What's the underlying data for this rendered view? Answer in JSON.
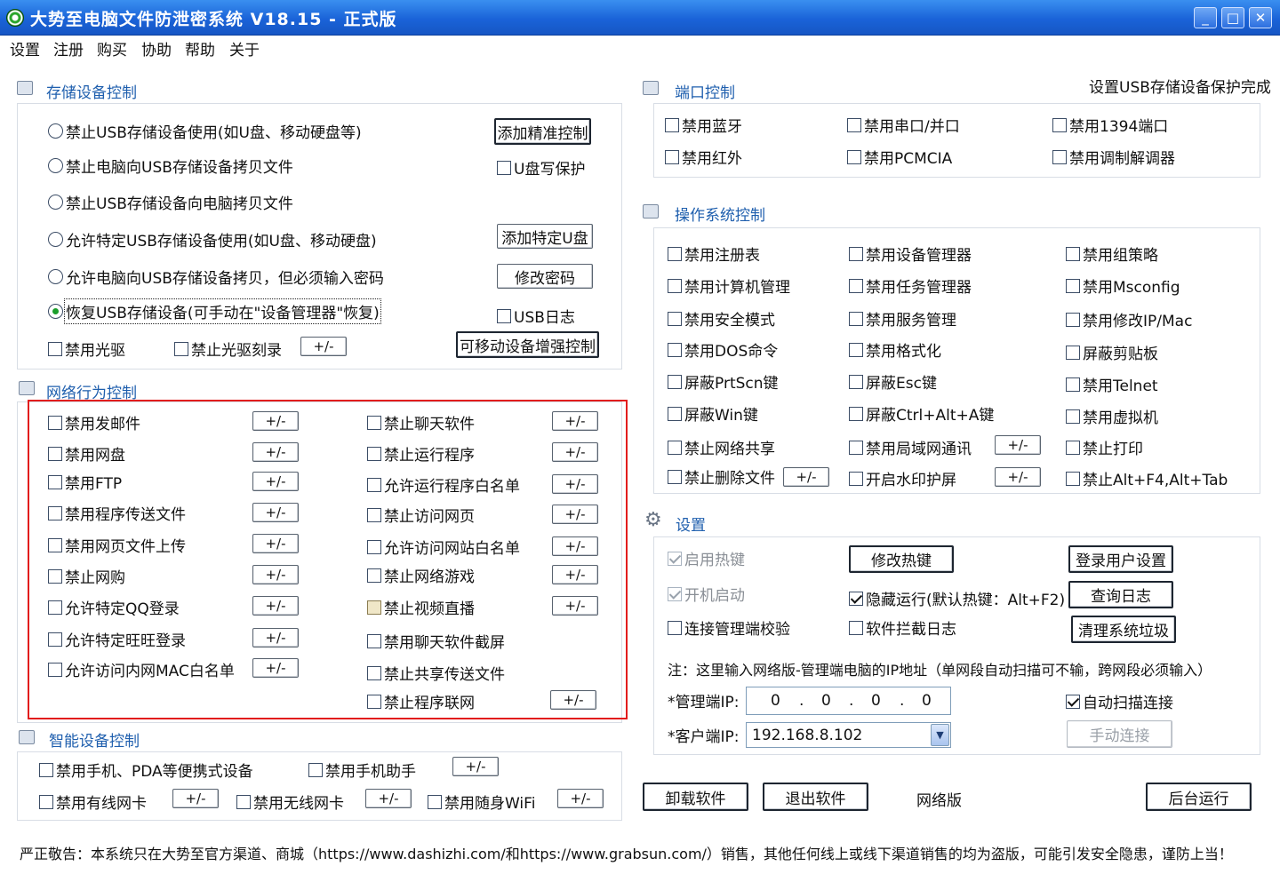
{
  "window": {
    "title": "大势至电脑文件防泄密系统 V18.15 - 正式版",
    "minimize": "_",
    "maximize": "□",
    "close": "✕"
  },
  "menu": [
    "设置",
    "注册",
    "购买",
    "协助",
    "帮助",
    "关于"
  ],
  "storage": {
    "title": "存储设备控制",
    "radios": [
      {
        "label": "禁止USB存储设备使用(如U盘、移动硬盘等)",
        "checked": false
      },
      {
        "label": "禁止电脑向USB存储设备拷贝文件",
        "checked": false
      },
      {
        "label": "禁止USB存储设备向电脑拷贝文件",
        "checked": false
      },
      {
        "label": "允许特定USB存储设备使用(如U盘、移动硬盘)",
        "checked": false
      },
      {
        "label": "允许电脑向USB存储设备拷贝，但必须输入密码",
        "checked": false
      },
      {
        "label": "恢复USB存储设备(可手动在\"设备管理器\"恢复)",
        "checked": true
      }
    ],
    "btn_precise": "添加精准控制",
    "cb_uwrite": "U盘写保护",
    "btn_add_udisk": "添加特定U盘",
    "btn_change_pwd": "修改密码",
    "cb_usblog": "USB日志",
    "cb_cdrom": "禁用光驱",
    "cb_burn": "禁止光驱刻录",
    "btn_pm": "+/-",
    "btn_mobile": "可移动设备增强控制"
  },
  "network": {
    "title": "网络行为控制",
    "left": [
      {
        "label": "禁用发邮件",
        "pm": "+/-"
      },
      {
        "label": "禁用网盘",
        "pm": "+/-"
      },
      {
        "label": "禁用FTP",
        "pm": "+/-"
      },
      {
        "label": "禁用程序传送文件",
        "pm": "+/-"
      },
      {
        "label": "禁用网页文件上传",
        "pm": "+/-"
      },
      {
        "label": "禁止网购",
        "pm": "+/-"
      },
      {
        "label": "允许特定QQ登录",
        "pm": "+/-"
      },
      {
        "label": "允许特定旺旺登录",
        "pm": "+/-"
      },
      {
        "label": "允许访问内网MAC白名单",
        "pm": "+/-"
      }
    ],
    "right": [
      {
        "label": "禁止聊天软件",
        "pm": "+/-"
      },
      {
        "label": "禁止运行程序",
        "pm": "+/-"
      },
      {
        "label": "允许运行程序白名单",
        "pm": "+/-"
      },
      {
        "label": "禁止访问网页",
        "pm": "+/-"
      },
      {
        "label": "允许访问网站白名单",
        "pm": "+/-"
      },
      {
        "label": "禁止网络游戏",
        "pm": "+/-"
      },
      {
        "label": "禁止视频直播",
        "pm": "+/-"
      },
      {
        "label": "禁用聊天软件截屏",
        "pm": ""
      },
      {
        "label": "禁止共享传送文件",
        "pm": ""
      },
      {
        "label": "禁止程序联网",
        "pm": "+/-"
      }
    ]
  },
  "smart": {
    "title": "智能设备控制",
    "phone": "禁用手机、PDA等便携式设备",
    "assistant": "禁用手机助手",
    "wired": "禁用有线网卡",
    "wireless": "禁用无线网卡",
    "wifi": "禁用随身WiFi",
    "pm": "+/-"
  },
  "status_text": "设置USB存储设备保护完成",
  "port": {
    "title": "端口控制",
    "items": [
      "禁用蓝牙",
      "禁用串口/并口",
      "禁用1394端口",
      "禁用红外",
      "禁用PCMCIA",
      "禁用调制解调器"
    ]
  },
  "os": {
    "title": "操作系统控制",
    "col1": [
      "禁用注册表",
      "禁用计算机管理",
      "禁用安全模式",
      "禁用DOS命令",
      "屏蔽PrtScn键",
      "屏蔽Win键",
      "禁止网络共享",
      "禁止删除文件"
    ],
    "col2": [
      "禁用设备管理器",
      "禁用任务管理器",
      "禁用服务管理",
      "禁用格式化",
      "屏蔽Esc键",
      "屏蔽Ctrl+Alt+A键",
      "禁用局域网通讯",
      "开启水印护屏"
    ],
    "col3": [
      "禁用组策略",
      "禁用Msconfig",
      "禁用修改IP/Mac",
      "屏蔽剪贴板",
      "禁用Telnet",
      "禁用虚拟机",
      "禁止打印",
      "禁止Alt+F4,Alt+Tab"
    ],
    "pm": "+/-"
  },
  "settings": {
    "title": "设置",
    "hotkey": "启用热键",
    "autostart": "开机启动",
    "verify": "连接管理端校验",
    "btn_hotkey": "修改热键",
    "hidden_run": "隐藏运行(默认热键：Alt+F2)",
    "intercept_log": "软件拦截日志",
    "btn_login": "登录用户设置",
    "btn_log": "查询日志",
    "btn_clean": "清理系统垃圾",
    "note": "注：这里输入网络版-管理端电脑的IP地址（单网段自动扫描可不输，跨网段必须输入）",
    "mgr_label": "*管理端IP:",
    "mgr_ip": [
      "0",
      "0",
      "0",
      "0"
    ],
    "client_label": "*客户端IP:",
    "client_ip": "192.168.8.102",
    "auto_scan": "自动扫描连接",
    "btn_manual": "手动连接"
  },
  "bottom": {
    "uninstall": "卸载软件",
    "exit": "退出软件",
    "edition": "网络版",
    "background": "后台运行"
  },
  "footer": "严正敬告：本系统只在大势至官方渠道、商城（https://www.dashizhi.com/和https://www.grabsun.com/）销售，其他任何线上或线下渠道销售的均为盗版，可能引发安全隐患，谨防上当！",
  "colors": {
    "titlebar": "#1a63d8",
    "group_title": "#1f5fae",
    "highlight_box": "#e21d1d",
    "radio_checked": "#1b9e2b"
  }
}
